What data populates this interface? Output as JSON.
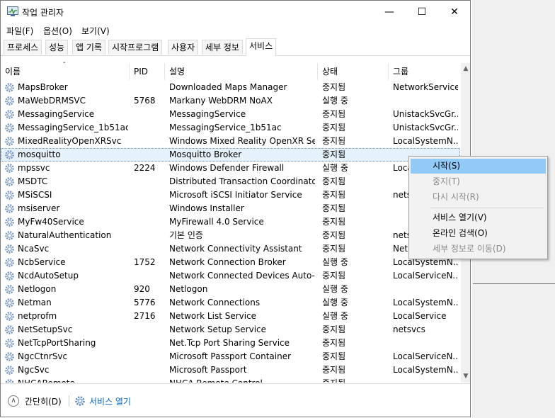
{
  "window": {
    "title": "작업 관리자",
    "controls": {
      "minimize": "—",
      "maximize": "☐",
      "close": "✕"
    }
  },
  "menu": [
    "파일(F)",
    "옵션(O)",
    "보기(V)"
  ],
  "tabs": [
    "프로세스",
    "성능",
    "앱 기록",
    "시작프로그램",
    "사용자",
    "세부 정보",
    "서비스"
  ],
  "active_tab": "서비스",
  "columns": [
    "이름",
    "PID",
    "설명",
    "상태",
    "그룹"
  ],
  "rows": [
    {
      "name": "MapsBroker",
      "pid": "",
      "desc": "Downloaded Maps Manager",
      "status": "중지됨",
      "group": "NetworkService"
    },
    {
      "name": "MaWebDRMSVC",
      "pid": "5768",
      "desc": "Markany WebDRM NoAX",
      "status": "실행 중",
      "group": ""
    },
    {
      "name": "MessagingService",
      "pid": "",
      "desc": "MessagingService",
      "status": "중지됨",
      "group": "UnistackSvcGr..."
    },
    {
      "name": "MessagingService_1b51ac",
      "pid": "",
      "desc": "MessagingService_1b51ac",
      "status": "중지됨",
      "group": "UnistackSvcGr..."
    },
    {
      "name": "MixedRealityOpenXRSvc",
      "pid": "",
      "desc": "Windows Mixed Reality OpenXR Ser...",
      "status": "중지됨",
      "group": "LocalSystemN..."
    },
    {
      "name": "mosquitto",
      "pid": "",
      "desc": "Mosquitto Broker",
      "status": "중지됨",
      "group": ""
    },
    {
      "name": "mpssvc",
      "pid": "2224",
      "desc": "Windows Defender Firewall",
      "status": "실행 중",
      "group": "Local"
    },
    {
      "name": "MSDTC",
      "pid": "",
      "desc": "Distributed Transaction Coordinator",
      "status": "중지됨",
      "group": ""
    },
    {
      "name": "MSiSCSI",
      "pid": "",
      "desc": "Microsoft iSCSI Initiator Service",
      "status": "중지됨",
      "group": "nets"
    },
    {
      "name": "msiserver",
      "pid": "",
      "desc": "Windows Installer",
      "status": "중지됨",
      "group": ""
    },
    {
      "name": "MyFw40Service",
      "pid": "",
      "desc": "MyFirewall 4.0 Service",
      "status": "중지됨",
      "group": ""
    },
    {
      "name": "NaturalAuthentication",
      "pid": "",
      "desc": "기본 인증",
      "status": "중지됨",
      "group": "nets"
    },
    {
      "name": "NcaSvc",
      "pid": "",
      "desc": "Network Connectivity Assistant",
      "status": "중지됨",
      "group": "Net"
    },
    {
      "name": "NcbService",
      "pid": "1752",
      "desc": "Network Connection Broker",
      "status": "실행 중",
      "group": "LocalSystemN..."
    },
    {
      "name": "NcdAutoSetup",
      "pid": "",
      "desc": "Network Connected Devices Auto-...",
      "status": "중지됨",
      "group": "LocalServiceN..."
    },
    {
      "name": "Netlogon",
      "pid": "920",
      "desc": "Netlogon",
      "status": "실행 중",
      "group": ""
    },
    {
      "name": "Netman",
      "pid": "5776",
      "desc": "Network Connections",
      "status": "실행 중",
      "group": "LocalSystemN..."
    },
    {
      "name": "netprofm",
      "pid": "2716",
      "desc": "Network List Service",
      "status": "실행 중",
      "group": "LocalService"
    },
    {
      "name": "NetSetupSvc",
      "pid": "",
      "desc": "Network Setup Service",
      "status": "중지됨",
      "group": "netsvcs"
    },
    {
      "name": "NetTcpPortSharing",
      "pid": "",
      "desc": "Net.Tcp Port Sharing Service",
      "status": "중지됨",
      "group": ""
    },
    {
      "name": "NgcCtnrSvc",
      "pid": "",
      "desc": "Microsoft Passport Container",
      "status": "중지됨",
      "group": "LocalServiceN..."
    },
    {
      "name": "NgcSvc",
      "pid": "",
      "desc": "Microsoft Passport",
      "status": "중지됨",
      "group": "LocalSystemN..."
    },
    {
      "name": "NHCARemote",
      "pid": "",
      "desc": "NHCA Remote Control",
      "status": "중지됨",
      "group": ""
    }
  ],
  "selected_row": "mosquitto",
  "context_menu": [
    {
      "label": "시작(S)",
      "state": "hover"
    },
    {
      "label": "중지(T)",
      "state": "disabled"
    },
    {
      "label": "다시 시작(R)",
      "state": "disabled"
    },
    {
      "label": "서비스 열기(V)",
      "state": "normal"
    },
    {
      "label": "온라인 검색(O)",
      "state": "normal"
    },
    {
      "label": "세부 정보로 이동(D)",
      "state": "disabled"
    }
  ],
  "footer": {
    "fewer_details": "간단히(D)",
    "open_services": "서비스 열기"
  },
  "icons": {
    "service": "gear-icon",
    "app": "task-manager-icon"
  },
  "colors": {
    "selected_row": "#e5f1fb",
    "menu_hover": "#91c9f7",
    "link": "#0066cc"
  }
}
